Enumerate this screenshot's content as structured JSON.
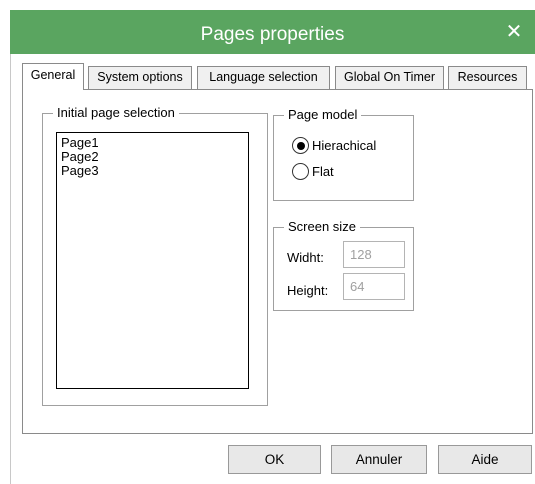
{
  "dialog": {
    "title": "Pages properties",
    "close_glyph": "✕",
    "title_bar_color": "#5aa560"
  },
  "tabs": [
    {
      "label": "General",
      "active": true
    },
    {
      "label": "System options",
      "active": false
    },
    {
      "label": "Language selection",
      "active": false
    },
    {
      "label": "Global On Timer",
      "active": false
    },
    {
      "label": "Resources",
      "active": false
    }
  ],
  "initial_page_selection": {
    "label": "Initial page selection",
    "items": [
      "Page1",
      "Page2",
      "Page3"
    ]
  },
  "page_model": {
    "label": "Page model",
    "options": [
      {
        "label": "Hierachical",
        "selected": true
      },
      {
        "label": "Flat",
        "selected": false
      }
    ]
  },
  "screen_size": {
    "label": "Screen size",
    "width_label": "Widht:",
    "width_value": "128",
    "height_label": "Height:",
    "height_value": "64"
  },
  "buttons": {
    "ok": "OK",
    "cancel": "Annuler",
    "help": "Aide"
  },
  "icons": {
    "close": "close-icon",
    "radio": "radio-button"
  }
}
